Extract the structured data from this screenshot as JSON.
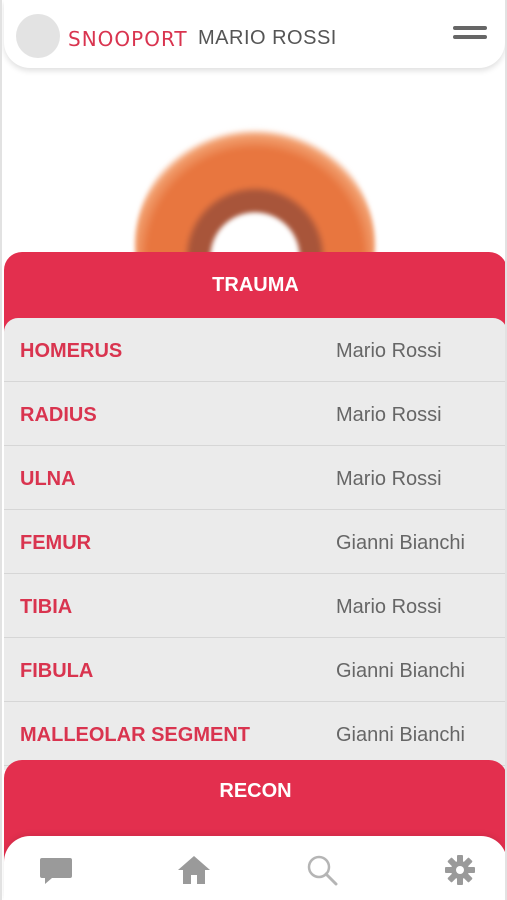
{
  "header": {
    "brand": "SNOOPORT",
    "user_name": "MARIO ROSSI"
  },
  "sections": {
    "trauma": {
      "title": "TRAUMA",
      "items": [
        {
          "name": "HOMERUS",
          "owner": "Mario Rossi"
        },
        {
          "name": "RADIUS",
          "owner": "Mario Rossi"
        },
        {
          "name": "ULNA",
          "owner": "Mario Rossi"
        },
        {
          "name": "FEMUR",
          "owner": "Gianni Bianchi"
        },
        {
          "name": "TIBIA",
          "owner": "Mario Rossi"
        },
        {
          "name": "FIBULA",
          "owner": "Gianni Bianchi"
        },
        {
          "name": "MALLEOLAR SEGMENT",
          "owner": "Gianni Bianchi"
        }
      ]
    },
    "recon": {
      "title": "RECON"
    }
  },
  "bottom_nav": [
    {
      "icon": "chat-icon"
    },
    {
      "icon": "home-icon"
    },
    {
      "icon": "search-icon"
    },
    {
      "icon": "gear-icon"
    }
  ],
  "colors": {
    "accent": "#e32f4e",
    "accent_text": "#d9344f",
    "list_bg": "#ebebeb",
    "icon_gray": "#9a9a9a"
  }
}
